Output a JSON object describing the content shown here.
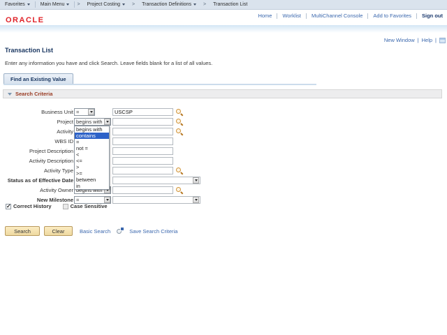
{
  "breadcrumb": {
    "favorites": "Favorites",
    "main_menu": "Main Menu",
    "crumbs": [
      "Project Costing",
      "Transaction Definitions",
      "Transaction List"
    ]
  },
  "header": {
    "logo": "ORACLE",
    "links": [
      "Home",
      "Worklist",
      "MultiChannel Console",
      "Add to Favorites"
    ],
    "sign_out": "Sign out"
  },
  "utility": {
    "new_window": "New Window",
    "help": "Help"
  },
  "page": {
    "title": "Transaction List",
    "instructions": "Enter any information you have and click Search. Leave fields blank for a list of all values.",
    "tab_label": "Find an Existing Value",
    "section_title": "Search Criteria"
  },
  "form": {
    "rows": [
      {
        "label": "Business Unit",
        "operator": "=",
        "value": "USCSP"
      },
      {
        "label": "Project",
        "operator": "begins with",
        "value": ""
      },
      {
        "label": "Activity",
        "value": ""
      },
      {
        "label": "WBS ID",
        "value": ""
      },
      {
        "label": "Project Description",
        "value": ""
      },
      {
        "label": "Activity Description",
        "value": ""
      },
      {
        "label": "Activity Type",
        "value": ""
      },
      {
        "label": "Status as of Effective Date",
        "value": ""
      },
      {
        "label": "Activity Owner",
        "operator": "begins with",
        "value": ""
      },
      {
        "label": "New Milestone",
        "operator": "=",
        "value": ""
      }
    ],
    "operator_dropdown": {
      "options": [
        "begins with",
        "contains",
        "=",
        "not =",
        "<",
        "<=",
        ">",
        ">=",
        "between",
        "in"
      ],
      "highlighted": "contains"
    },
    "checkboxes": [
      {
        "label": "Correct History",
        "checked": true
      },
      {
        "label": "Case Sensitive",
        "checked": false
      }
    ]
  },
  "actions": {
    "search": "Search",
    "clear": "Clear",
    "basic_search": "Basic Search",
    "save_search_criteria": "Save Search Criteria"
  },
  "colors": {
    "link_blue": "#3a67ad",
    "navy": "#17345f",
    "oracle_red": "#e0242a",
    "section_title_red": "#993a22",
    "highlight_blue": "#2d62c8",
    "button_face": "#f2dfa8",
    "topbar_bg": "#dae3ed"
  }
}
